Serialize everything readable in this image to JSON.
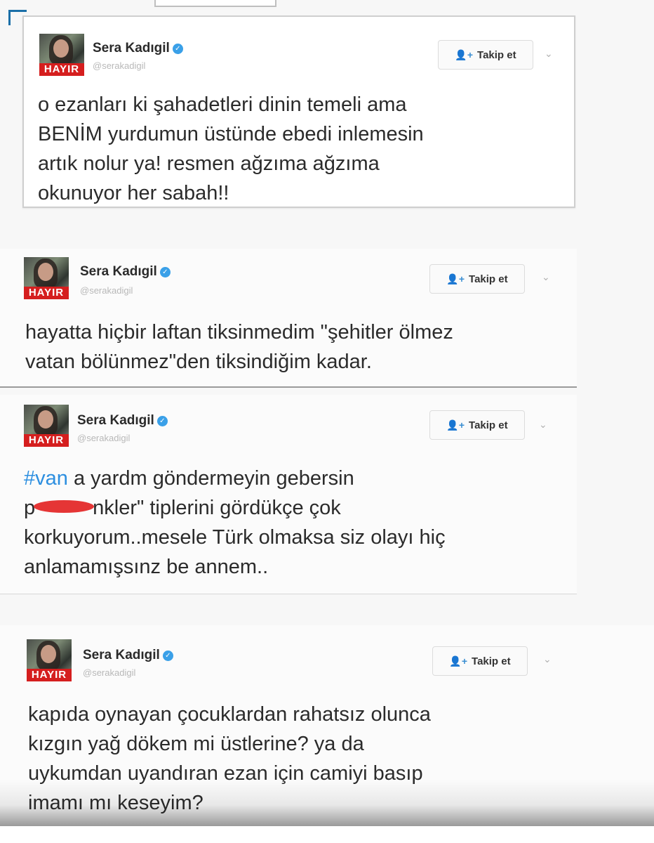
{
  "tweets": [
    {
      "name": "Sera Kadıgil",
      "handle": "@serakadigil",
      "avatar_text": "HAYIR",
      "follow_label": "Takip et",
      "lines": [
        "o ezanları ki şahadetleri dinin temeli ama",
        "BENİM yurdumun üstünde ebedi inlemesin",
        "artık nolur ya! resmen ağzıma ağzıma",
        "okunuyor her sabah!!"
      ]
    },
    {
      "name": "Sera Kadıgil",
      "handle": "@serakadigil",
      "avatar_text": "HAYIR",
      "follow_label": "Takip et",
      "lines": [
        "hayatta hiçbir laftan tiksinmedim \"şehitler ölmez",
        "vatan bölünmez\"den tiksindiğim kadar."
      ]
    },
    {
      "name": "Sera Kadıgil",
      "handle": "@serakadigil",
      "avatar_text": "HAYIR",
      "follow_label": "Takip et",
      "hashtag": "#van",
      "line1_rest": " a yardm göndermeyin gebersin",
      "line2_start": "p",
      "line2_rest": "nkler\" tiplerini gördükçe çok",
      "lines": [
        "korkuyorum..mesele Türk olmaksa siz olayı hiç",
        "anlamamışsınz be annem.."
      ]
    },
    {
      "name": "Sera Kadıgil",
      "handle": "@serakadigil",
      "avatar_text": "HAYIR",
      "follow_label": "Takip et",
      "lines": [
        "kapıda oynayan çocuklardan rahatsız olunca",
        "kızgın yağ dökem mi üstlerine? ya da",
        "uykumdan uyandıran ezan için camiyi basıp",
        "imamı mı keseyim?"
      ]
    }
  ],
  "colors": {
    "accent": "#2d8fe0",
    "verified": "#3aa0e8",
    "redaction": "#e53535",
    "avatar_banner": "#d51e1e"
  },
  "icons": {
    "verified": "verified-badge-icon",
    "follow": "add-user-icon",
    "caret": "chevron-down-icon"
  }
}
